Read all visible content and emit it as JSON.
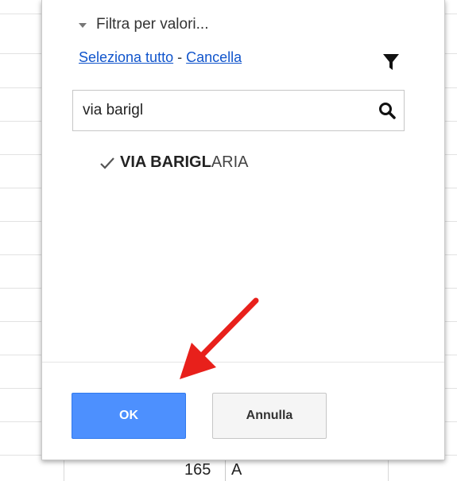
{
  "filter_panel": {
    "section_title": "Filtra per valori...",
    "select_all_link": "Seleziona tutto",
    "separator": "-",
    "clear_link": "Cancella",
    "search": {
      "value": "via barigl",
      "placeholder": ""
    },
    "values": [
      {
        "matched": "VIA BARIGL",
        "rest": "ARIA",
        "checked": true
      }
    ],
    "ok_label": "OK",
    "cancel_label": "Annulla"
  },
  "sheet": {
    "bottom_row_number": "165",
    "bottom_row_letter": "A"
  },
  "colors": {
    "ok_button": "#4d90fe",
    "link": "#1155cc",
    "annotation_arrow": "#e8201b"
  }
}
